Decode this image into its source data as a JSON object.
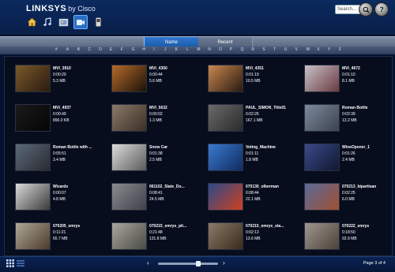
{
  "header": {
    "brand": "LINKSYS",
    "brand_sub": "by Cisco",
    "nav_icons": [
      "home-icon",
      "music-icon",
      "photo-icon",
      "video-icon",
      "device-icon"
    ],
    "search_placeholder": "Search..."
  },
  "tabs": [
    {
      "label": "Name",
      "active": true
    },
    {
      "label": "Recent",
      "active": false
    }
  ],
  "alphabet": [
    "#",
    "A",
    "B",
    "C",
    "D",
    "E",
    "F",
    "G",
    "H",
    "I",
    "J",
    "K",
    "L",
    "M",
    "N",
    "O",
    "P",
    "Q",
    "R",
    "S",
    "T",
    "U",
    "V",
    "W",
    "X",
    "Y",
    "Z"
  ],
  "media_items": [
    {
      "title": "MVI_3910",
      "duration": "0:00:29",
      "size": "5.3 MB",
      "thumb": [
        "#7a5a2a",
        "#2a1a10"
      ]
    },
    {
      "title": "MVI_4350",
      "duration": "0:00:44",
      "size": "5.6 MB",
      "thumb": [
        "#b76a2a",
        "#1a1208"
      ]
    },
    {
      "title": "MVI_4351",
      "duration": "0:01:19",
      "size": "10.5 MB",
      "thumb": [
        "#c88850",
        "#2a1a10"
      ]
    },
    {
      "title": "MVI_4672",
      "duration": "0:01:10",
      "size": "8.1 MB",
      "thumb": [
        "#c7c2c8",
        "#6a3a40"
      ]
    },
    {
      "title": "MVI_4937",
      "duration": "0:00:49",
      "size": "890.0 KB",
      "thumb": [
        "#1a1a1a",
        "#050505"
      ]
    },
    {
      "title": "MVI_5632",
      "duration": "0:00:02",
      "size": "1.3 MB",
      "thumb": [
        "#8a7a6a",
        "#3a2e24"
      ]
    },
    {
      "title": "PAUL_SIMON_Title01",
      "duration": "0:02:26",
      "size": "167.1 MB",
      "thumb": [
        "#6a6a6a",
        "#2a2a2a"
      ]
    },
    {
      "title": "Roman Bottle",
      "duration": "0:02:39",
      "size": "13.2 MB",
      "thumb": [
        "#7d8a9a",
        "#3a4250"
      ]
    },
    {
      "title": "Roman Bottle with ...",
      "duration": "0:05:51",
      "size": "3.4 MB",
      "thumb": [
        "#5a6a7a",
        "#2a2a30"
      ]
    },
    {
      "title": "Snow Car",
      "duration": "0:01:38",
      "size": "2.5 MB",
      "thumb": [
        "#dcdcdc",
        "#5a5a5a"
      ]
    },
    {
      "title": "Voting_Machine",
      "duration": "0:01:11",
      "size": "1.8 MB",
      "thumb": [
        "#3a7ad0",
        "#102a60"
      ]
    },
    {
      "title": "WineOpener_1",
      "duration": "0:01:26",
      "size": "2.4 MB",
      "thumb": [
        "#3a4a8a",
        "#101830"
      ]
    },
    {
      "title": "Wizards",
      "duration": "0:00:07",
      "size": "4.8 MB",
      "thumb": [
        "#dadada",
        "#3a3a3a"
      ]
    },
    {
      "title": "061102_Slate_Do...",
      "duration": "0:08:41",
      "size": "24.5 MB",
      "thumb": [
        "#8a8a90",
        "#40404a"
      ]
    },
    {
      "title": "070130_olberman",
      "duration": "0:08:44",
      "size": "22.1 MB",
      "thumb": [
        "#2a4a8a",
        "#d04020"
      ]
    },
    {
      "title": "070213_bipartisan",
      "duration": "0:02:25",
      "size": "6.0 MB",
      "thumb": [
        "#5a6a9a",
        "#a05030"
      ]
    },
    {
      "title": "070205_emrys",
      "duration": "0:11:21",
      "size": "65.7 MB",
      "thumb": [
        "#b0a898",
        "#4a3a2a"
      ]
    },
    {
      "title": "070215_emrys_pit...",
      "duration": "0:21:48",
      "size": "131.8 MB",
      "thumb": [
        "#a8a8a0",
        "#4a4a44"
      ]
    },
    {
      "title": "070215_emrys_sta...",
      "duration": "0:02:13",
      "size": "13.6 MB",
      "thumb": [
        "#8a7a6a",
        "#3a2a1a"
      ]
    },
    {
      "title": "070222_emrys",
      "duration": "0:18:50",
      "size": "92.9 MB",
      "thumb": [
        "#a09890",
        "#4a4038"
      ]
    }
  ],
  "pager": {
    "label": "Page 3 of 4",
    "prev": "‹",
    "next": "›",
    "position_fraction": 0.67
  }
}
